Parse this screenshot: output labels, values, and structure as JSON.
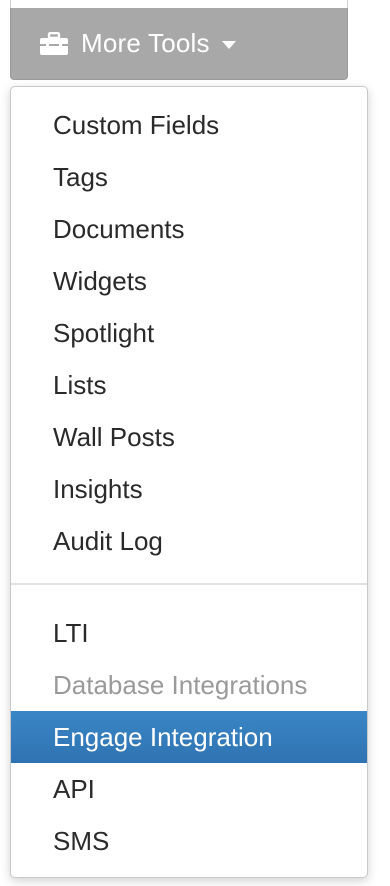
{
  "button": {
    "label": "More Tools",
    "icon": "toolbox-icon"
  },
  "menu": {
    "group1": [
      "Custom Fields",
      "Tags",
      "Documents",
      "Widgets",
      "Spotlight",
      "Lists",
      "Wall Posts",
      "Insights",
      "Audit Log"
    ],
    "group2": [
      {
        "label": "LTI",
        "state": "normal"
      },
      {
        "label": "Database Integrations",
        "state": "disabled"
      },
      {
        "label": "Engage Integration",
        "state": "active"
      },
      {
        "label": "API",
        "state": "normal"
      },
      {
        "label": "SMS",
        "state": "normal"
      }
    ]
  },
  "colors": {
    "button_bg": "#a8a8a8",
    "active_bg": "#2f73b2",
    "disabled_text": "#9a9a9a",
    "text": "#2a2a2a"
  }
}
